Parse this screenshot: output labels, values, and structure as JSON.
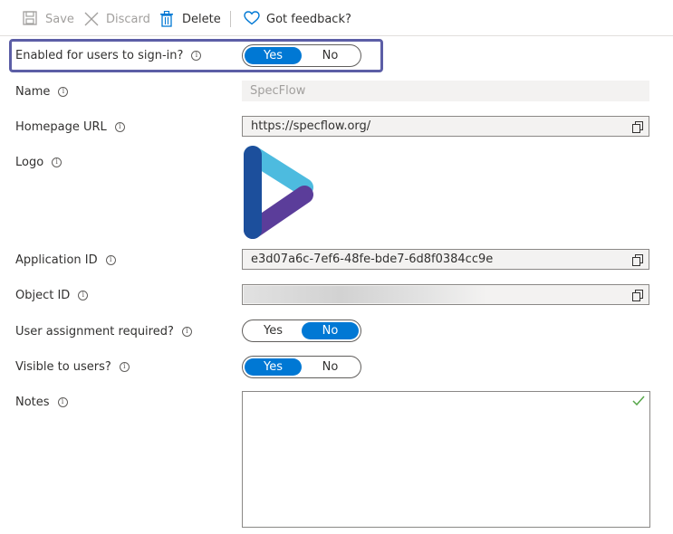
{
  "toolbar": {
    "save_label": "Save",
    "discard_label": "Discard",
    "delete_label": "Delete",
    "feedback_label": "Got feedback?"
  },
  "form": {
    "enabled_label": "Enabled for users to sign-in?",
    "enabled_yes": "Yes",
    "enabled_no": "No",
    "enabled_value": "Yes",
    "name_label": "Name",
    "name_value": "SpecFlow",
    "homepage_label": "Homepage URL",
    "homepage_value": "https://specflow.org/",
    "logo_label": "Logo",
    "appid_label": "Application ID",
    "appid_value": "e3d07a6c-7ef6-48fe-bde7-6d8f0384cc9e",
    "objectid_label": "Object ID",
    "assignment_label": "User assignment required?",
    "assignment_yes": "Yes",
    "assignment_no": "No",
    "assignment_value": "No",
    "visible_label": "Visible to users?",
    "visible_yes": "Yes",
    "visible_no": "No",
    "visible_value": "Yes",
    "notes_label": "Notes",
    "notes_value": ""
  },
  "icons": {
    "save": "save-icon",
    "discard": "close-icon",
    "delete": "trash-icon",
    "feedback": "heart-icon",
    "info": "info-icon",
    "copy": "copy-icon",
    "check": "check-icon"
  },
  "colors": {
    "accent": "#0078d4",
    "highlight_border": "#5c5ea6",
    "logo_dark_blue": "#1c4f9c",
    "logo_light_blue": "#4dbbdf",
    "logo_purple": "#5b3d9a",
    "check_green": "#57a64a"
  }
}
